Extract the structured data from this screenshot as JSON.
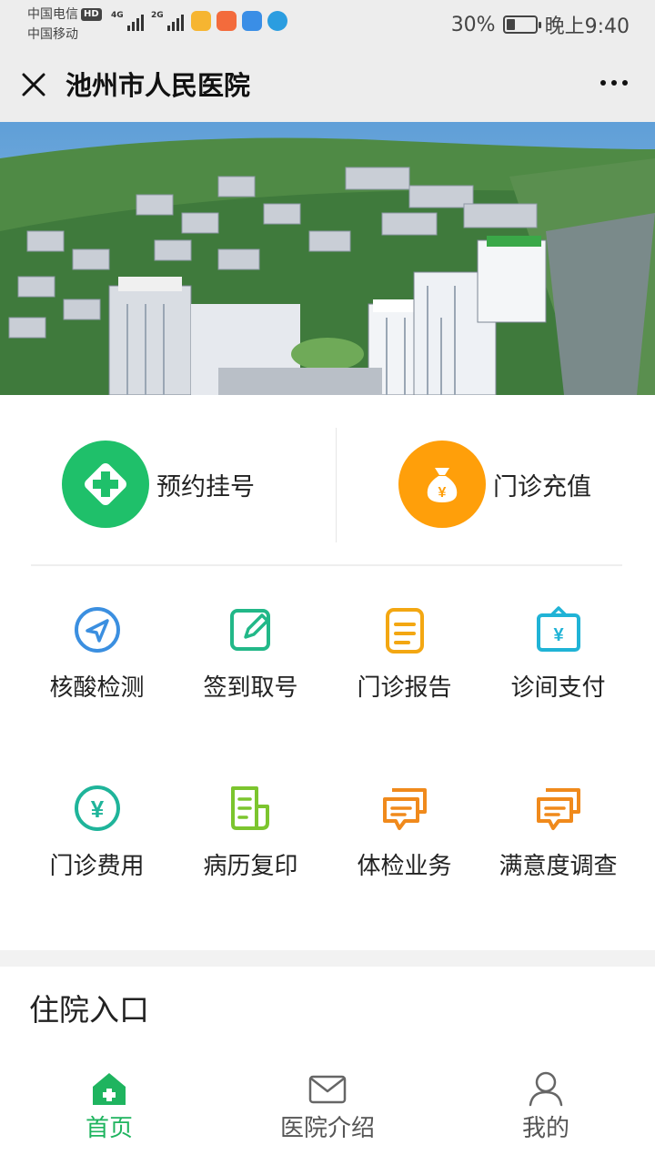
{
  "status_bar": {
    "carrier_1": "中国电信",
    "hd_badge": "HD",
    "carrier_2": "中国移动",
    "network_1": "4G",
    "network_2": "2G",
    "battery_percent": "30%",
    "battery_level": 0.3,
    "time": "晚上9:40"
  },
  "nav": {
    "title": "池州市人民医院",
    "close_icon": "close-icon",
    "more_icon": "more-dots-icon"
  },
  "quick_actions": [
    {
      "label": "预约挂号",
      "icon": "medical-cross-icon",
      "color": "#1fc06a"
    },
    {
      "label": "门诊充值",
      "icon": "money-bag-icon",
      "color": "#ff9f0a"
    }
  ],
  "services": [
    {
      "label": "核酸检测",
      "icon": "navigation-arrow-icon",
      "color": "#3b8fe0"
    },
    {
      "label": "签到取号",
      "icon": "edit-note-icon",
      "color": "#22b888"
    },
    {
      "label": "门诊报告",
      "icon": "report-list-icon",
      "color": "#f3a712"
    },
    {
      "label": "诊间支付",
      "icon": "payment-sign-icon",
      "color": "#20b3d6"
    },
    {
      "label": "门诊费用",
      "icon": "yen-circle-icon",
      "color": "#1fb49a"
    },
    {
      "label": "病历复印",
      "icon": "document-copy-icon",
      "color": "#7cc52e"
    },
    {
      "label": "体检业务",
      "icon": "chat-bubbles-icon",
      "color": "#f08a1c"
    },
    {
      "label": "满意度调查",
      "icon": "chat-bubbles-icon",
      "color": "#f08a1c"
    }
  ],
  "section": {
    "title": "住院入口"
  },
  "tabs": [
    {
      "label": "首页",
      "icon": "home-icon",
      "active": true
    },
    {
      "label": "医院介绍",
      "icon": "mail-icon",
      "active": false
    },
    {
      "label": "我的",
      "icon": "user-icon",
      "active": false
    }
  ],
  "colors": {
    "accent": "#1fb45f",
    "nav_bg": "#ededed"
  }
}
